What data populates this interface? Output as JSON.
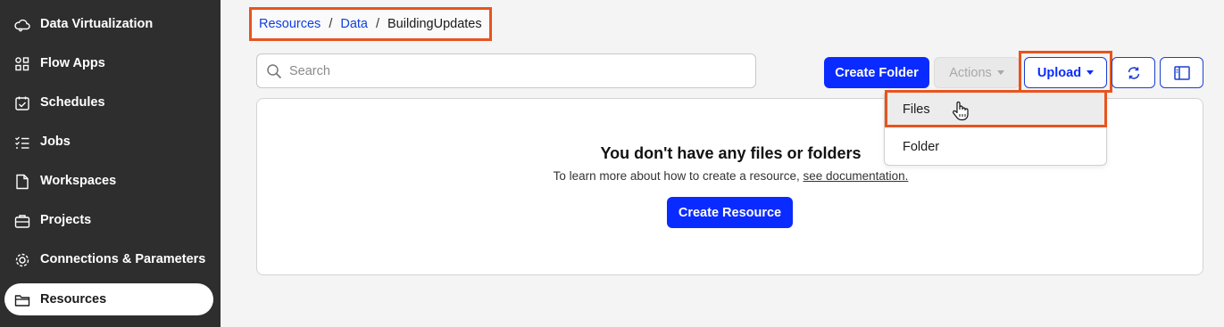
{
  "sidebar": {
    "items": [
      {
        "label": "Data Virtualization",
        "icon": "cloud-icon"
      },
      {
        "label": "Flow Apps",
        "icon": "grid-icon"
      },
      {
        "label": "Schedules",
        "icon": "calendar-check-icon"
      },
      {
        "label": "Jobs",
        "icon": "checklist-icon"
      },
      {
        "label": "Workspaces",
        "icon": "document-icon"
      },
      {
        "label": "Projects",
        "icon": "briefcase-icon"
      },
      {
        "label": "Connections & Parameters",
        "icon": "gear-network-icon"
      },
      {
        "label": "Resources",
        "icon": "folder-icon",
        "active": true
      }
    ]
  },
  "breadcrumb": {
    "items": [
      "Resources",
      "Data",
      "BuildingUpdates"
    ],
    "separator": "/"
  },
  "search": {
    "placeholder": "Search",
    "value": ""
  },
  "toolbar": {
    "create_folder": "Create Folder",
    "actions": "Actions",
    "upload": "Upload",
    "refresh_icon": "refresh-icon",
    "panel_icon": "side-panel-icon"
  },
  "empty_state": {
    "title": "You don't have any files or folders",
    "subtitle": "To learn more about how to create a resource,",
    "link": "see documentation.",
    "button": "Create Resource"
  },
  "upload_menu": {
    "items": [
      "Files",
      "Folder"
    ],
    "hovered": "Files"
  },
  "colors": {
    "sidebar_bg": "#2e2e2e",
    "primary": "#0a2bff",
    "highlight": "#e8541e",
    "link": "#0f3fe0"
  }
}
